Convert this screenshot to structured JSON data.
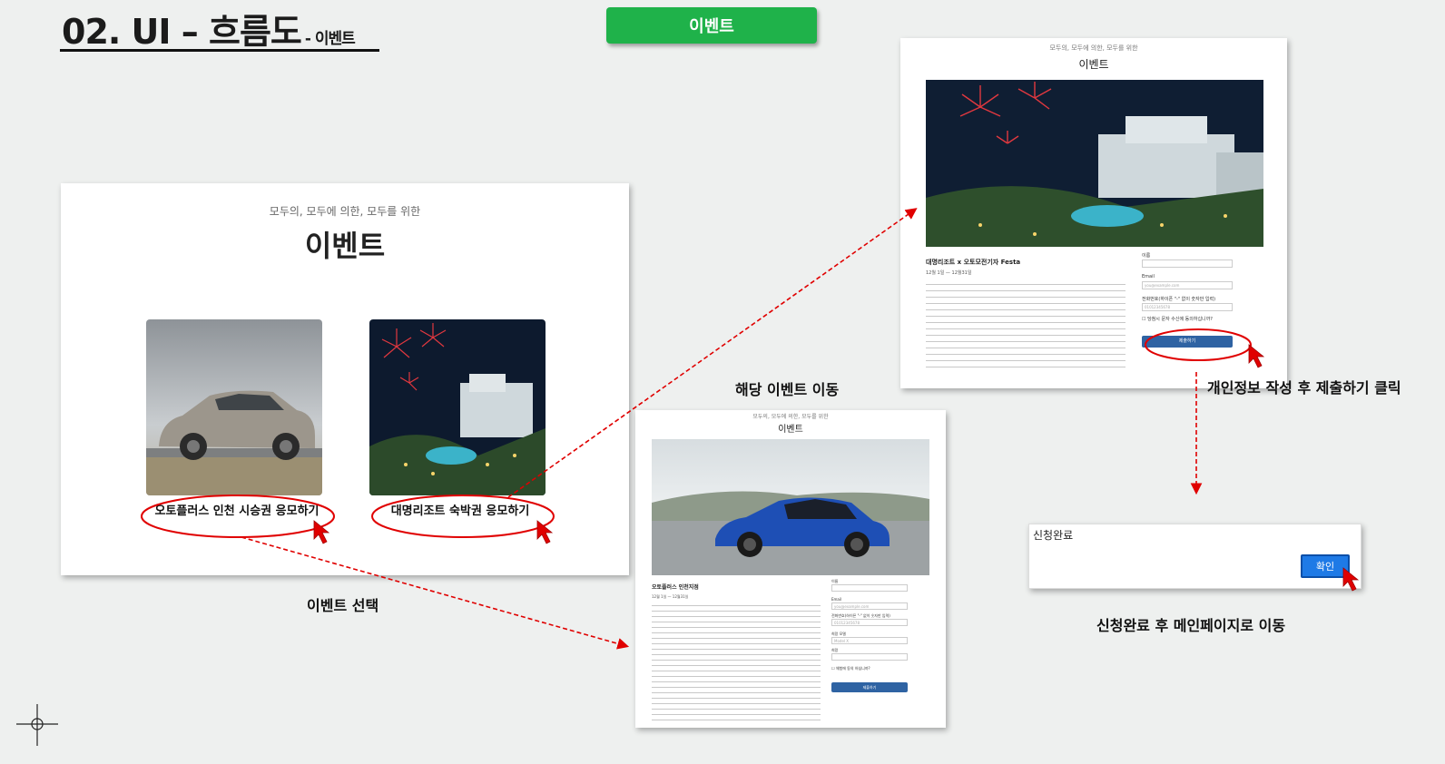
{
  "header": {
    "title": "02. UI – 흐름도",
    "subtitle": "- 이벤트",
    "tag": "이벤트"
  },
  "event_list": {
    "tagline": "모두의, 모두에 의한, 모두를 위한",
    "title": "이벤트",
    "events": [
      {
        "label": "오토플러스 인천 시승권 응모하기"
      },
      {
        "label": "대명리조트 숙박권 응모하기"
      }
    ],
    "caption": "이벤트 선택"
  },
  "resort_form": {
    "tagline": "모두의, 모두에 의한, 모두를 위한",
    "title": "이벤트",
    "event_name": "대명리조트 x 오토모전기자 Festa",
    "period": "12월 1일 — 12월31일",
    "fields": [
      {
        "label": "이름",
        "placeholder": ""
      },
      {
        "label": "Email",
        "placeholder": "you@example.com"
      },
      {
        "label": "전화번호(하이픈 \"-\" 없이 숫자만 입력)",
        "placeholder": "01012345678"
      }
    ],
    "consent": "당첨시 문자 수신에 동의하십니까?",
    "submit": "제출하기",
    "caption": "개인정보 작성 후 제출하기 클릭"
  },
  "auto_form": {
    "tagline": "모두의, 모두에 의한, 모두를 위한",
    "title": "이벤트",
    "event_name": "오토플러스 인천지점",
    "period": "12월 1일 — 12월31일",
    "fields": [
      {
        "label": "이름",
        "placeholder": ""
      },
      {
        "label": "Email",
        "placeholder": "you@example.com"
      },
      {
        "label": "전화번호(하이픈 \"-\" 없이 숫자만 입력)",
        "placeholder": "01012345678"
      },
      {
        "label": "희망 모델",
        "placeholder": "Model X"
      },
      {
        "label": "희망",
        "placeholder": ""
      }
    ],
    "consent": "체험에 동의 하십니까?",
    "submit": "제출하기",
    "caption": "해당 이벤트 이동"
  },
  "completion": {
    "title": "신청완료",
    "confirm": "확인",
    "caption": "신청완료 후 메인페이지로 이동"
  },
  "colors": {
    "accent_green": "#1fb24a",
    "annotation_red": "#e00000",
    "submit_blue": "#2f63a3",
    "confirm_blue": "#1e7ae6"
  }
}
